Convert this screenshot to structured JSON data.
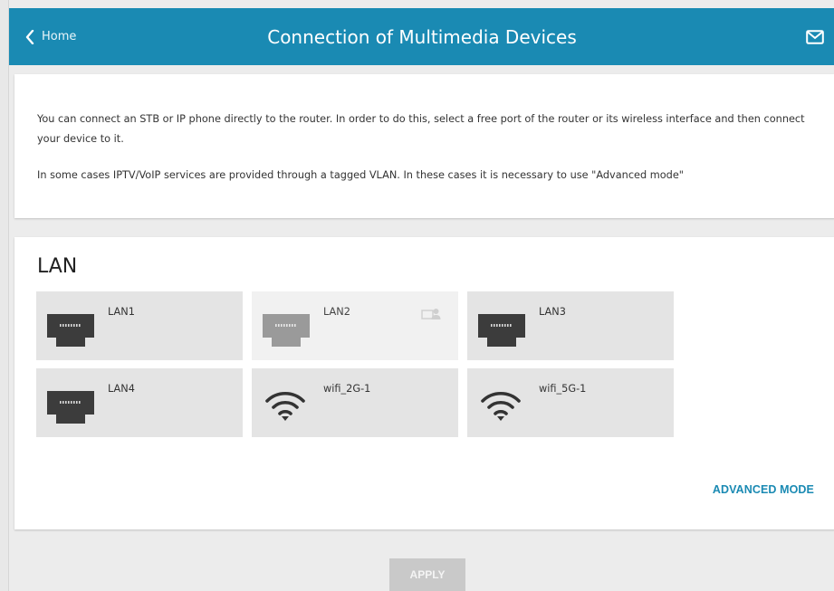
{
  "header": {
    "back_label": "Home",
    "title": "Connection of Multimedia Devices",
    "icons": [
      "chevron-left-icon",
      "mail-icon"
    ]
  },
  "info": {
    "paragraph1": "You can connect an STB or IP phone directly to the router. In order to do this, select a free port of the router or its wireless interface and then connect your device to it.",
    "paragraph2": "In some cases IPTV/VoIP services are provided through a tagged VLAN. In these cases it is necessary to use \"Advanced mode\""
  },
  "lan": {
    "title": "LAN",
    "ports": [
      {
        "label": "LAN1",
        "type": "ethernet",
        "enabled": true
      },
      {
        "label": "LAN2",
        "type": "ethernet",
        "enabled": false,
        "badge": "user-device-icon"
      },
      {
        "label": "LAN3",
        "type": "ethernet",
        "enabled": true
      },
      {
        "label": "LAN4",
        "type": "ethernet",
        "enabled": true
      },
      {
        "label": "wifi_2G-1",
        "type": "wifi",
        "enabled": true
      },
      {
        "label": "wifi_5G-1",
        "type": "wifi",
        "enabled": true
      }
    ],
    "advanced_label": "ADVANCED MODE"
  },
  "footer": {
    "apply_label": "APPLY"
  },
  "colors": {
    "accent": "#1a8ab3",
    "tile": "#e4e4e4",
    "tile_disabled": "#f1f1f1",
    "button_disabled": "#c9c9c9"
  }
}
